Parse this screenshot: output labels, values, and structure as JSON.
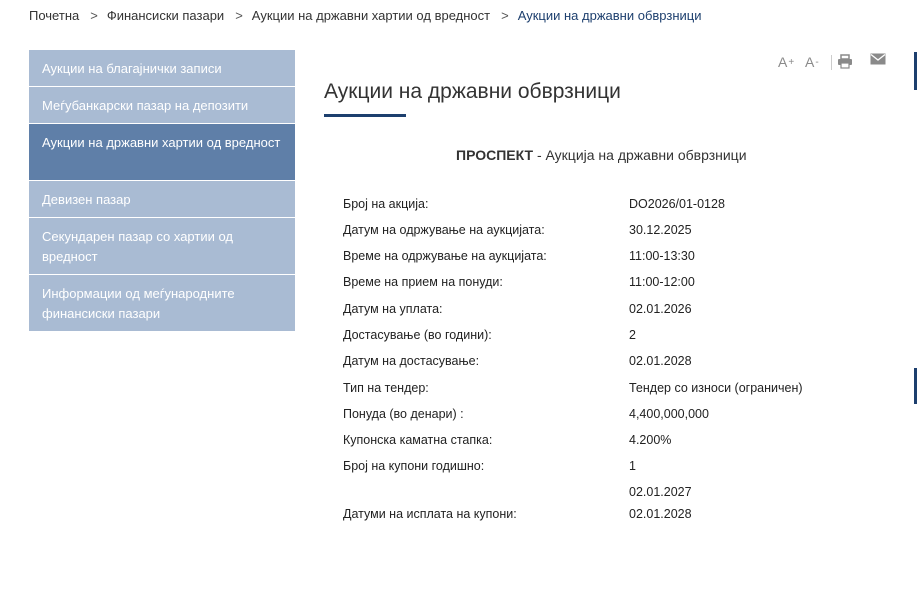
{
  "breadcrumb": [
    {
      "label": "Почетна"
    },
    {
      "label": "Финансиски пазари"
    },
    {
      "label": "Аукции на државни хартии од вредност"
    },
    {
      "label": "Аукции на државни обврзници"
    }
  ],
  "breadcrumb_separator": ">",
  "sidebar": {
    "items": [
      {
        "label": "Аукции на благајнички записи"
      },
      {
        "label": "Меѓубанкарски пазар на депозити"
      },
      {
        "label": "Аукции на државни хартии од вредност"
      },
      {
        "label": "Девизен пазар"
      },
      {
        "label": "Секундарен пазар со хартии од вредност"
      },
      {
        "label": "Информации од меѓународните финансиски пазари"
      }
    ]
  },
  "tools": {
    "increase_font": "A",
    "increase_sup": "+",
    "decrease_font": "A",
    "decrease_sup": "-",
    "print_icon": "printer-icon",
    "mail_icon": "envelope-icon"
  },
  "main": {
    "title": "Аукции на државни обврзници",
    "prospect_bold": "ПРОСПЕКТ",
    "prospect_rest": " - Аукција на државни обврзници",
    "rows": [
      {
        "label": "Број на акција:",
        "value": "DO2026/01-0128"
      },
      {
        "label": "Датум на одржување на аукцијата:",
        "value": "30.12.2025"
      },
      {
        "label": "Време на одржување на аукцијата:",
        "value": "11:00-13:30"
      },
      {
        "label": "Време на прием на понуди:",
        "value": "11:00-12:00"
      },
      {
        "label": "Датум на уплата:",
        "value": "02.01.2026"
      },
      {
        "label": "Достасување (во години):",
        "value": "2"
      },
      {
        "label": "Датум на достасување:",
        "value": "02.01.2028"
      },
      {
        "label": "Тип на тендер:",
        "value": "Тендер со износи (ограничен)"
      },
      {
        "label": "Понуда (во денари) :",
        "value": "4,400,000,000"
      },
      {
        "label": "Купонска каматна стапка:",
        "value": "4.200%"
      },
      {
        "label": "Број на купони годишно:",
        "value": "1"
      }
    ],
    "coupon_dates": {
      "label": "Датуми на исплата на купони:",
      "values": [
        "02.01.2027",
        "02.01.2028"
      ]
    }
  },
  "colors": {
    "sidebar_bg": "#a9bbd3",
    "sidebar_active_bg": "#5f7fa8",
    "accent": "#1d3f6e"
  }
}
